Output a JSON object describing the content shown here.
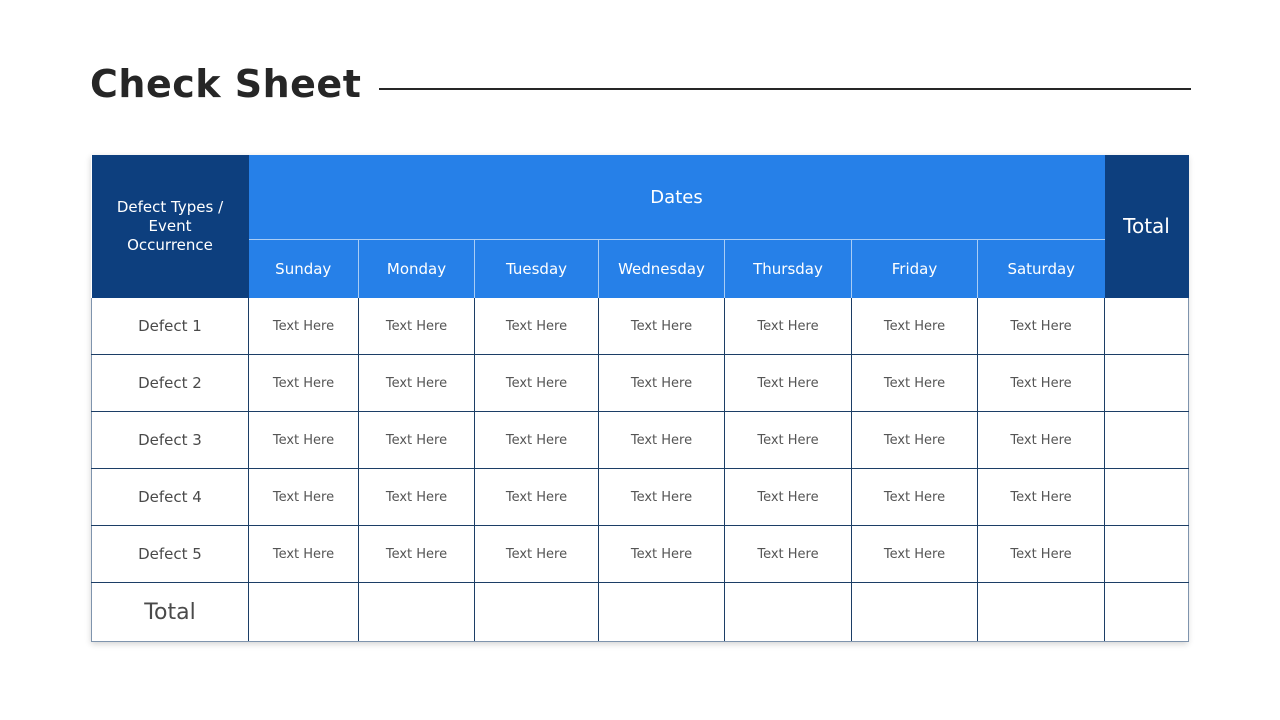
{
  "title": "Check Sheet",
  "table": {
    "corner_header": "Defect Types / Event Occurrence",
    "group_header": "Dates",
    "total_header": "Total",
    "days": [
      "Sunday",
      "Monday",
      "Tuesday",
      "Wednesday",
      "Thursday",
      "Friday",
      "Saturday"
    ],
    "rows": [
      {
        "label": "Defect 1",
        "cells": [
          "Text Here",
          "Text Here",
          "Text Here",
          "Text Here",
          "Text Here",
          "Text Here",
          "Text Here"
        ],
        "total": ""
      },
      {
        "label": "Defect 2",
        "cells": [
          "Text Here",
          "Text Here",
          "Text Here",
          "Text Here",
          "Text Here",
          "Text Here",
          "Text Here"
        ],
        "total": ""
      },
      {
        "label": "Defect 3",
        "cells": [
          "Text Here",
          "Text Here",
          "Text Here",
          "Text Here",
          "Text Here",
          "Text Here",
          "Text Here"
        ],
        "total": ""
      },
      {
        "label": "Defect 4",
        "cells": [
          "Text Here",
          "Text Here",
          "Text Here",
          "Text Here",
          "Text Here",
          "Text Here",
          "Text Here"
        ],
        "total": ""
      },
      {
        "label": "Defect 5",
        "cells": [
          "Text Here",
          "Text Here",
          "Text Here",
          "Text Here",
          "Text Here",
          "Text Here",
          "Text Here"
        ],
        "total": ""
      }
    ],
    "total_row": {
      "label": "Total",
      "cells": [
        "",
        "",
        "",
        "",
        "",
        "",
        ""
      ],
      "total": ""
    }
  },
  "colors": {
    "header_dark": "#0d3f7e",
    "header_bright": "#2680e8",
    "grid_line": "#1c3e66",
    "title_text": "#262626"
  }
}
